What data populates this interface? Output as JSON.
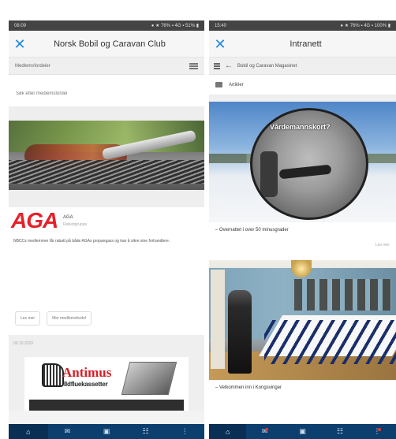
{
  "left_screen": {
    "status_time": "08:09",
    "status_right": "● ★ 76% ▪ 4G ▪ 51% ▮",
    "close_icon": "close-icon",
    "title": "Norsk Bobil og Caravan Club",
    "subbar_label": "Medlemsfordeler",
    "search_placeholder": "Søk etter medlemsfordel",
    "post": {
      "logo_text": "AGA",
      "name": "AGA",
      "subtitle": "Rabattgruppe",
      "body": "NBCCs medlemmer får rabatt på både AGAs propangass og kan å sikre sine forhandlere.",
      "btn_read": "Les mer",
      "btn_more": "Mer medlemsfordel",
      "date": "09.10.2020"
    },
    "ad": {
      "title": "Antimus",
      "subtitle": "Ildfluekassetter"
    },
    "tabs": [
      {
        "icon": "⌂",
        "name": "home"
      },
      {
        "icon": "✉",
        "name": "mail"
      },
      {
        "icon": "▣",
        "name": "calendar"
      },
      {
        "icon": "☷",
        "name": "members"
      },
      {
        "icon": "⋮",
        "name": "more"
      }
    ]
  },
  "right_screen": {
    "status_time": "15:40",
    "status_right": "● ★ 76% ▪ 4G ▪ 100% ▮",
    "close_icon": "close-icon",
    "title": "Intranett",
    "breadcrumb": "Bobil og Caravan Magasinet",
    "section_label": "Artikler",
    "article1": {
      "image_title": "Vårdemannskort?",
      "caption": "– Overnattet i over 50 minusgrader",
      "read_more": "Les mer"
    },
    "article2": {
      "caption": "– Velkommen inn i Kongsvinger"
    },
    "tabs": [
      {
        "icon": "⌂",
        "name": "home"
      },
      {
        "icon": "✉",
        "name": "mail"
      },
      {
        "icon": "▣",
        "name": "calendar"
      },
      {
        "icon": "☷",
        "name": "members"
      },
      {
        "icon": "⋮",
        "name": "more"
      }
    ]
  },
  "colors": {
    "accent_blue": "#1e88e5",
    "tabbar_navy": "#0d3f6e",
    "brand_red": "#e4222a"
  }
}
